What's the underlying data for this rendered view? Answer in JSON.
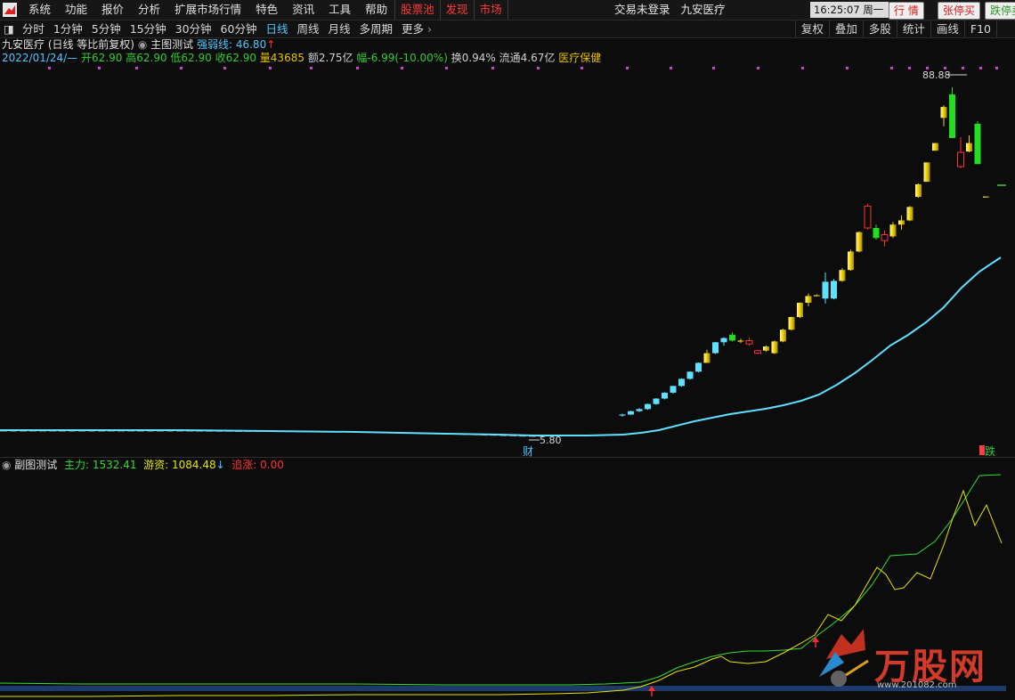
{
  "menu": {
    "items": [
      "系统",
      "功能",
      "报价",
      "分析",
      "扩展市场行情",
      "特色",
      "资讯",
      "工具",
      "帮助"
    ],
    "red_items": [
      "股票池",
      "发现",
      "市场"
    ],
    "login": "交易未登录",
    "stock_name": "九安医疗",
    "clock": "16:25:07 周一",
    "quote_btn": "行 情",
    "limit_up_btn": "张停买",
    "limit_down_btn": "跌停卖"
  },
  "toolbar": {
    "periods": [
      "分时",
      "1分钟",
      "5分钟",
      "15分钟",
      "30分钟",
      "60分钟",
      "日线",
      "周线",
      "月线",
      "多周期",
      "更多"
    ],
    "active_period": "日线",
    "right_items": [
      "复权",
      "叠加",
      "多股",
      "统计",
      "画线",
      "F10"
    ]
  },
  "info": {
    "title": "九安医疗 (日线 等比前复权)",
    "indicator_name": "主图测试",
    "strength_label": "强弱线:",
    "strength_value": "46.80",
    "date": "2022/01/24/—",
    "open": "开62.90",
    "high": "高62.90",
    "low": "低62.90",
    "close": "收62.90",
    "volume": "量43685",
    "amount": "额2.75亿",
    "change": "幅-6.99(-10.00%)",
    "turnover": "换0.94%",
    "float_cap": "流通4.67亿",
    "sector": "医疗保健"
  },
  "chart_labels": {
    "max_price": "88.88",
    "min_price": "5.80",
    "marker_cai": "财",
    "marker_die": "跌"
  },
  "sub": {
    "name": "副图测试",
    "zhuli_label": "主力:",
    "zhuli_value": "1532.41",
    "youzi_label": "游资:",
    "youzi_value": "1084.48",
    "zhuizhang_label": "追涨:",
    "zhuizhang_value": "0.00"
  },
  "watermark": {
    "text": "万股网",
    "url": "www.201082.com"
  },
  "chart_data": {
    "type": "candlestick",
    "price_range": [
      5.8,
      88.88
    ],
    "candles": [
      [
        10.8,
        11.2,
        10.5,
        11.0
      ],
      [
        11.0,
        11.9,
        10.9,
        11.8
      ],
      [
        11.8,
        12.5,
        11.6,
        12.3
      ],
      [
        12.3,
        13.6,
        12.1,
        13.5
      ],
      [
        13.5,
        14.9,
        13.3,
        14.8
      ],
      [
        14.8,
        16.3,
        14.6,
        16.2
      ],
      [
        16.2,
        17.8,
        16.0,
        17.8
      ],
      [
        17.8,
        19.6,
        17.6,
        19.5
      ],
      [
        19.5,
        21.3,
        19.3,
        21.2
      ],
      [
        21.2,
        23.4,
        21.0,
        23.3
      ],
      [
        23.3,
        26.4,
        23.3,
        25.6
      ],
      [
        25.6,
        28.3,
        25.4,
        28.2
      ],
      [
        28.2,
        29.4,
        27.4,
        29.2
      ],
      [
        30.0,
        30.6,
        28.4,
        28.6
      ],
      [
        28.6,
        29.0,
        28.0,
        28.6
      ],
      [
        28.6,
        29.2,
        27.4,
        27.8
      ],
      [
        25.6,
        26.4,
        25.4,
        26.2
      ],
      [
        26.2,
        27.4,
        26.0,
        27.2
      ],
      [
        25.6,
        28.6,
        25.4,
        28.4
      ],
      [
        28.4,
        31.4,
        28.2,
        31.2
      ],
      [
        31.2,
        34.3,
        31.0,
        34.2
      ],
      [
        34.2,
        37.7,
        34.0,
        37.6
      ],
      [
        37.6,
        39.8,
        36.8,
        39.2
      ],
      [
        39.2,
        39.6,
        39.2,
        39.4
      ],
      [
        42.6,
        44.8,
        37.4,
        38.6
      ],
      [
        38.6,
        43.2,
        38.4,
        42.8
      ],
      [
        42.8,
        45.8,
        42.6,
        45.4
      ],
      [
        45.4,
        50.2,
        45.2,
        49.8
      ],
      [
        49.8,
        54.6,
        49.6,
        54.4
      ],
      [
        60.6,
        61.2,
        55.0,
        55.4
      ],
      [
        55.4,
        56.2,
        52.6,
        53.0
      ],
      [
        52.4,
        54.8,
        51.0,
        53.8
      ],
      [
        53.4,
        56.8,
        53.0,
        56.2
      ],
      [
        56.2,
        58.4,
        55.0,
        57.2
      ],
      [
        57.2,
        60.6,
        57.0,
        60.4
      ],
      [
        62.8,
        66.0,
        62.6,
        65.8
      ],
      [
        66.4,
        71.0,
        66.4,
        71.0
      ],
      [
        73.8,
        75.6,
        73.8,
        75.6
      ],
      [
        81.6,
        84.6,
        79.6,
        84.2
      ],
      [
        87.2,
        88.88,
        76.8,
        76.8
      ],
      [
        70.0,
        77.0,
        69.6,
        73.4
      ],
      [
        73.6,
        77.4,
        73.4,
        75.6
      ],
      [
        80.2,
        80.8,
        70.6,
        70.6
      ],
      [
        62.9,
        62.9,
        62.9,
        62.9
      ]
    ],
    "ma_series": [
      "flat ~ 10.8 through mid-chart, then rising to ~62 at the last bar"
    ],
    "sub_series": [
      {
        "name": "主力",
        "color": "#33dd33",
        "last": 1532.41
      },
      {
        "name": "游资",
        "color": "#e6e600",
        "last": 1084.48
      }
    ]
  }
}
